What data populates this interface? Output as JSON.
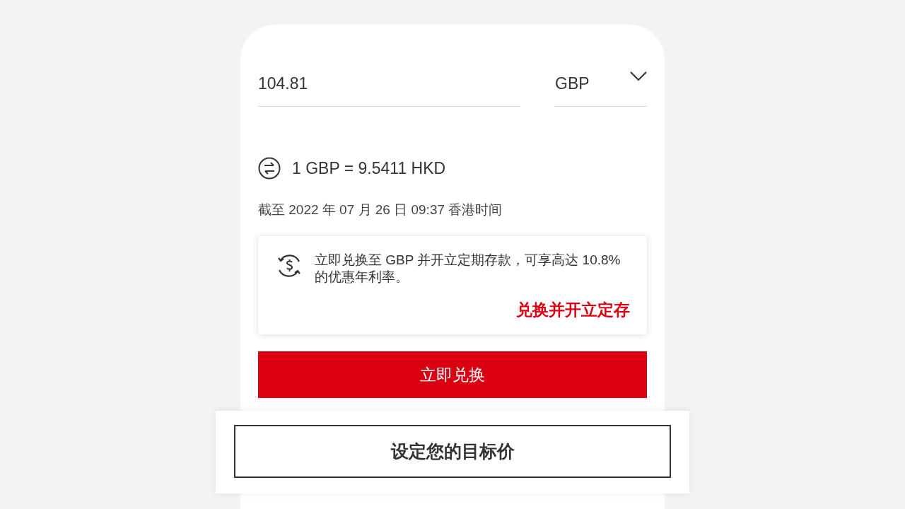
{
  "amount": {
    "value": "104.81"
  },
  "currency": {
    "value": "GBP"
  },
  "rate": {
    "text": "1 GBP = 9.5411 HKD"
  },
  "timestamp": "截至 2022 年 07 月 26 日 09:37 香港时间",
  "promo": {
    "text": "立即兑换至 GBP 并开立定期存款，可享高达 10.8% 的优惠年利率。",
    "link": "兑换并开立定存"
  },
  "primary_button": "立即兑换",
  "secondary_button": "设定您的目标价"
}
